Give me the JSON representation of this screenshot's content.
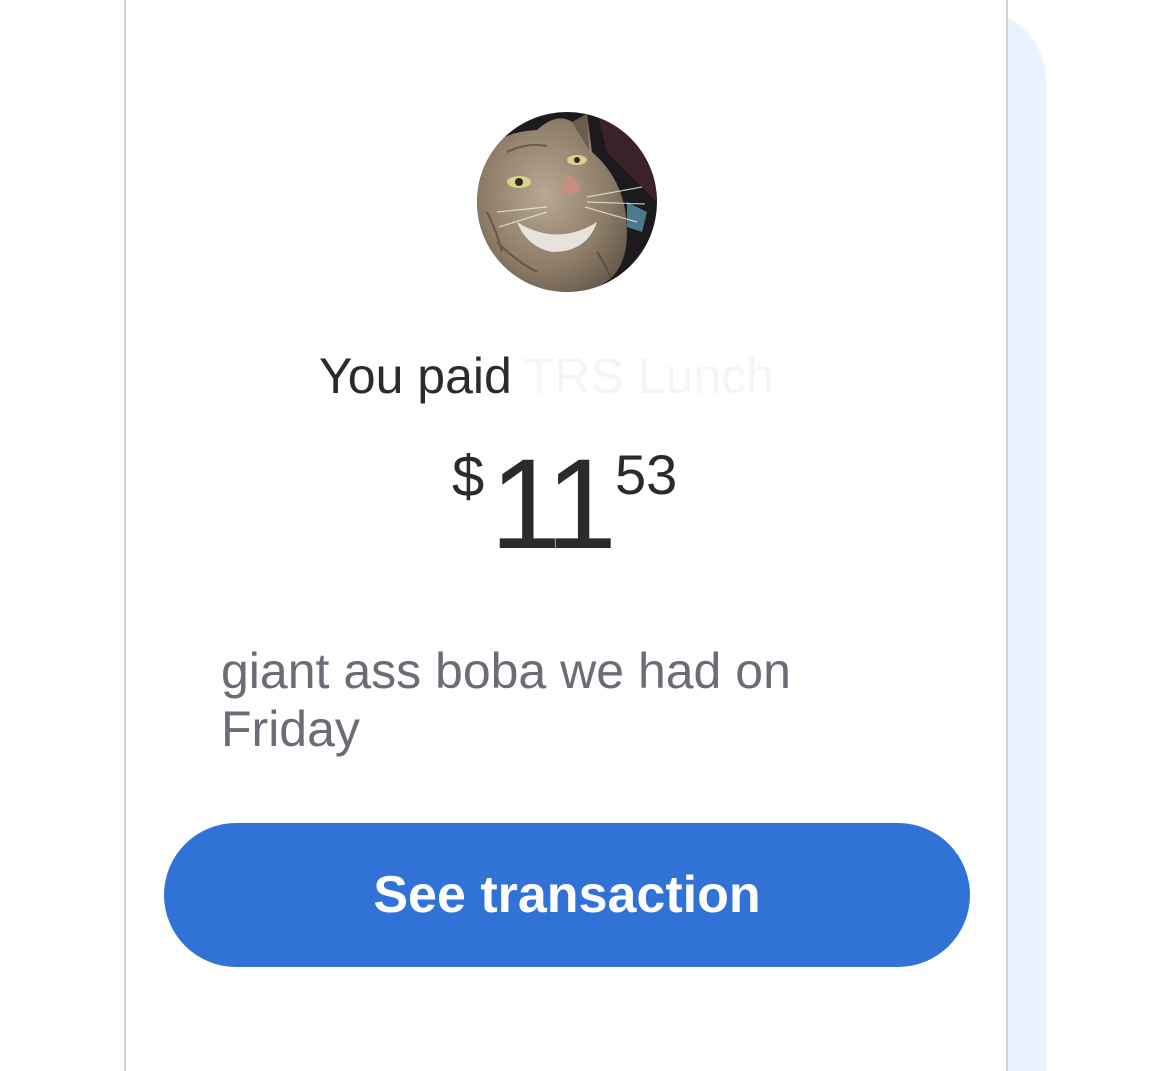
{
  "payment": {
    "prefix": "You paid",
    "recipient": "TRS Lunch",
    "currency_symbol": "$",
    "amount_dollars": "11",
    "amount_cents": "53",
    "note": "giant ass boba we had on Friday"
  },
  "actions": {
    "see_transaction_label": "See transaction"
  },
  "colors": {
    "accent": "#3072d6",
    "text_primary": "#2b2b2e",
    "text_secondary": "#6a6d75",
    "card_border": "#cfd3d8",
    "shadow_tint": "#e9f2fd"
  }
}
